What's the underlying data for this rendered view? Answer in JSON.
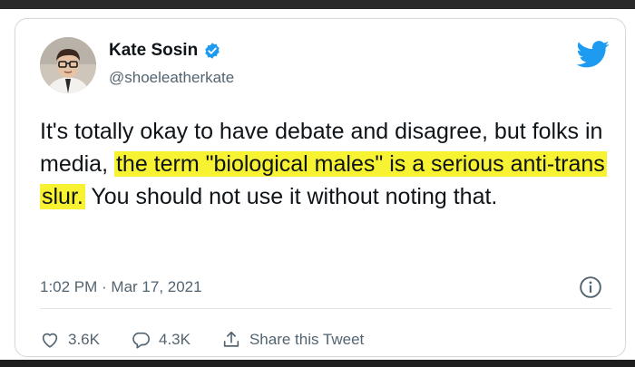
{
  "author": {
    "display_name": "Kate Sosin",
    "handle": "@shoeleatherkate",
    "verified": true
  },
  "tweet": {
    "text_part1": "It's totally okay to have debate and disagree, but folks in media, ",
    "text_highlight": "the term \"biological males\" is a serious anti-trans slur.",
    "text_part2": " You should not use it without noting that.",
    "timestamp": "1:02 PM · Mar 17, 2021"
  },
  "actions": {
    "likes": "3.6K",
    "replies": "4.3K",
    "share_label": "Share this Tweet"
  },
  "icons": {
    "brand": "twitter-bird-icon",
    "verified": "verified-badge-icon",
    "info": "info-icon",
    "like": "heart-icon",
    "reply": "reply-bubble-icon",
    "share": "share-icon"
  },
  "colors": {
    "twitter_blue": "#1d9bf0",
    "highlight": "#f7f232",
    "text": "#0f1419",
    "muted": "#536471"
  }
}
